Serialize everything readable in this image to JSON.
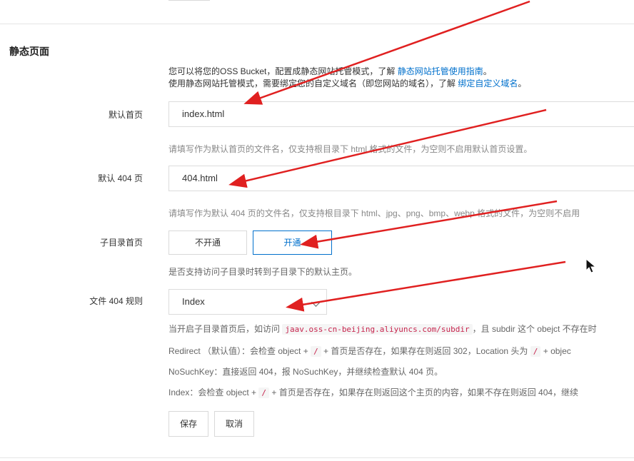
{
  "section": {
    "title": "静态页面"
  },
  "intro": {
    "line1_prefix": "您可以将您的OSS Bucket，配置成静态网站托管模式，了解 ",
    "line1_link": "静态网站托管使用指南",
    "line1_suffix": "。",
    "line2_prefix": "使用静态网站托管模式，需要绑定您的自定义域名（即您网站的域名），了解 ",
    "line2_link": "绑定自定义域名",
    "line2_suffix": "。"
  },
  "index_page": {
    "label": "默认首页",
    "value": "index.html",
    "hint": "请填写作为默认首页的文件名，仅支持根目录下 html 格式的文件，为空则不启用默认首页设置。"
  },
  "error_page": {
    "label": "默认 404 页",
    "value": "404.html",
    "hint": "请填写作为默认 404 页的文件名，仅支持根目录下 html、jpg、png、bmp、webp 格式的文件，为空则不启用"
  },
  "subdir_index": {
    "label": "子目录首页",
    "off_label": "不开通",
    "on_label": "开通",
    "selected": "开通",
    "hint": "是否支持访问子目录时转到子目录下的默认主页。"
  },
  "file_404_rule": {
    "label": "文件 404 规则",
    "selected": "Index",
    "rule1_prefix": "当开启子目录首页后，如访问 ",
    "rule1_code": "jaav.oss-cn-beijing.aliyuncs.com/subdir",
    "rule1_suffix": "，且 subdir 这个 obejct 不存在时",
    "rule2_prefix": "Redirect （默认值）：会检查 object + ",
    "rule2_code1": "/",
    "rule2_middle": " + 首页是否存在，如果存在则返回 302，Location 头为 ",
    "rule2_code2": "/",
    "rule2_suffix": " + objec",
    "rule3": "NoSuchKey：直接返回 404，报 NoSuchKey，并继续检查默认 404 页。",
    "rule4_prefix": "Index：会检查 object + ",
    "rule4_code": "/",
    "rule4_suffix": " + 首页是否存在，如果存在则返回这个主页的内容，如果不存在则返回 404，继续"
  },
  "actions": {
    "save": "保存",
    "cancel": "取消"
  },
  "colors": {
    "accent": "#0070cc",
    "annotation_arrow": "#e02020"
  },
  "icons": {
    "select_toggle": "chevron-down-icon",
    "cursor": "mouse-pointer-icon"
  }
}
